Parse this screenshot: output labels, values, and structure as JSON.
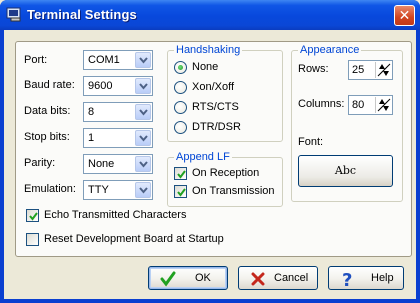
{
  "window": {
    "title": "Terminal Settings"
  },
  "fields": [
    {
      "label": "Port:",
      "value": "COM1"
    },
    {
      "label": "Baud rate:",
      "value": "9600"
    },
    {
      "label": "Data bits:",
      "value": "8"
    },
    {
      "label": "Stop bits:",
      "value": "1"
    },
    {
      "label": "Parity:",
      "value": "None"
    },
    {
      "label": "Emulation:",
      "value": "TTY"
    }
  ],
  "handshaking": {
    "title": "Handshaking",
    "options": [
      {
        "label": "None",
        "selected": true
      },
      {
        "label": "Xon/Xoff",
        "selected": false
      },
      {
        "label": "RTS/CTS",
        "selected": false
      },
      {
        "label": "DTR/DSR",
        "selected": false
      }
    ]
  },
  "append_lf": {
    "title": "Append LF",
    "on_reception": {
      "label": "On Reception",
      "checked": true
    },
    "on_transmission": {
      "label": "On Transmission",
      "checked": true
    }
  },
  "appearance": {
    "title": "Appearance",
    "rows": {
      "label": "Rows:",
      "value": "25"
    },
    "columns": {
      "label": "Columns:",
      "value": "80"
    },
    "font": {
      "label": "Font:",
      "sample": "Abc"
    }
  },
  "options": {
    "echo": {
      "label": "Echo Transmitted Characters",
      "checked": true
    },
    "reset": {
      "label": "Reset Development Board at Startup",
      "checked": false
    }
  },
  "buttons": {
    "ok": "OK",
    "cancel": "Cancel",
    "help": "Help"
  },
  "colors": {
    "title_bar": "#0a48d8",
    "group_title": "#0046d5",
    "check_mark": "#21a121",
    "cancel_x": "#c4271c",
    "help_q": "#1f4fbf"
  }
}
